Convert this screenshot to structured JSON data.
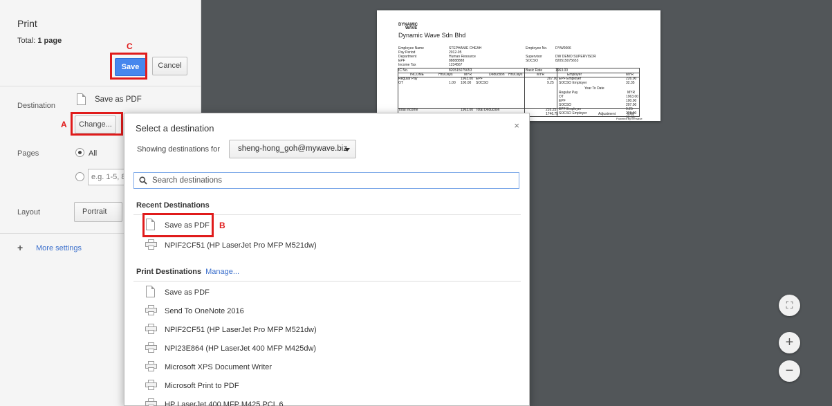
{
  "sidebar": {
    "title": "Print",
    "total_label": "Total:",
    "total_value": "1 page",
    "save_label": "Save",
    "cancel_label": "Cancel",
    "destination_label": "Destination",
    "destination_value": "Save as PDF",
    "change_label": "Change...",
    "pages_label": "Pages",
    "pages_all": "All",
    "pages_placeholder": "e.g. 1-5, 8",
    "layout_label": "Layout",
    "layout_value": "Portrait",
    "more_settings": "More settings",
    "more_icon": "+"
  },
  "annotations": {
    "a": "A",
    "b": "B",
    "c": "C"
  },
  "preview": {
    "logo_top": "DYNAMIC",
    "logo_bottom": "WAVE",
    "company": "Dynamic Wave Sdn Bhd",
    "labels_left": [
      "Employee Name",
      "Pay Period",
      "Department",
      "EPF",
      "Income Tax"
    ],
    "values_left": [
      "STEPHANIE CHEAH",
      "2012-05",
      "Human Resource",
      "88888888",
      "1234567"
    ],
    "labels_right": [
      "Employee No.",
      "",
      "Supervisor",
      "SOCSO"
    ],
    "values_right": [
      "DYW0006",
      "",
      "DW DEMO SUPERVISOR",
      "820515075653"
    ],
    "ic_label": "IC No.",
    "ic_value": "820515075653",
    "basic_rate_label": "Basic Rate",
    "basic_rate_value": "1963.00",
    "col_heads": [
      "INCOME",
      "Hrs/Days",
      "MYR",
      "Deduction",
      "Hrs/Days",
      "MYR",
      "Employer",
      "MYR"
    ],
    "row1": [
      "Regular Pay",
      "",
      "1963.00",
      "EPF",
      "",
      "207.00",
      "EPF Employer",
      "226.00"
    ],
    "row2": [
      "OT",
      "1.00",
      "100.00",
      "SOCSO",
      "",
      "9.25",
      "SOCSO Employer",
      "32.35"
    ],
    "ytd_title": "Year To Date",
    "ytd_myr": "MYR",
    "ytd_lines": [
      "Regular Pay",
      "OT",
      "EPF",
      "SOCSO",
      "EPF Employer",
      "SOCSO Employer"
    ],
    "ytd_values": [
      "1963.00",
      "100.00",
      "207.00",
      "9.25",
      "226.00",
      "32.35"
    ],
    "total_income_label": "Total Income",
    "total_income": "1963.00",
    "total_deduction_label": "Total Deduction",
    "total_deduction": "216.25",
    "net": "1746.75",
    "adjustment_label": "Adjustment",
    "adjustment": "0.00",
    "powered": "Powered by MYwave"
  },
  "dialog": {
    "title": "Select a destination",
    "close": "×",
    "showing_label": "Showing destinations for",
    "account": "sheng-hong_goh@mywave.biz",
    "search_placeholder": "Search destinations",
    "recent_head": "Recent Destinations",
    "recent": [
      "Save as PDF",
      "NPIF2CF51 (HP LaserJet Pro MFP M521dw)"
    ],
    "print_head": "Print Destinations",
    "manage": "Manage...",
    "print_list": [
      "Save as PDF",
      "Send To OneNote 2016",
      "NPIF2CF51 (HP LaserJet Pro MFP M521dw)",
      "NPI23E864 (HP LaserJet 400 MFP M425dw)",
      "Microsoft XPS Document Writer",
      "Microsoft Print to PDF",
      "HP LaserJet 400 MFP M425 PCL 6"
    ]
  },
  "zoom": {
    "fit": "⛶",
    "in": "+",
    "out": "−"
  },
  "colors": {
    "accent": "#4787ed",
    "highlight": "#e01b1b",
    "viewer_bg": "#525659"
  }
}
